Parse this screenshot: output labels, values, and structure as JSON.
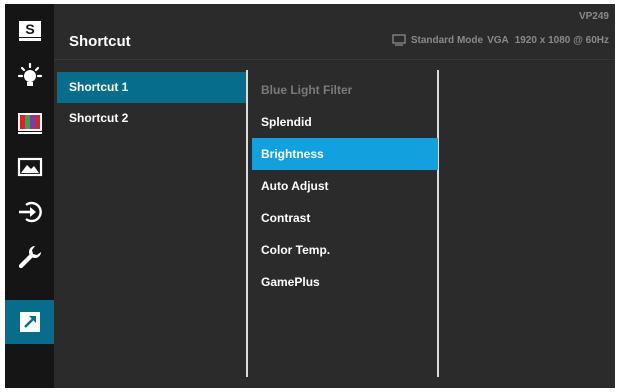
{
  "header": {
    "title": "Shortcut",
    "model": "VP249",
    "mode": "Standard Mode",
    "input": "VGA",
    "resolution": "1920 x 1080 @ 60Hz"
  },
  "sidebar": {
    "items": [
      {
        "icon": "splendid-s-icon"
      },
      {
        "icon": "blue-light-icon"
      },
      {
        "icon": "color-bars-icon"
      },
      {
        "icon": "image-icon"
      },
      {
        "icon": "input-select-icon"
      },
      {
        "icon": "system-setup-wrench-icon"
      },
      {
        "icon": "shortcut-arrow-icon",
        "active": true
      }
    ]
  },
  "shortcut_list": {
    "items": [
      {
        "label": "Shortcut 1",
        "selected": true
      },
      {
        "label": "Shortcut 2",
        "selected": false
      }
    ]
  },
  "function_list": {
    "items": [
      {
        "label": "Blue Light Filter",
        "state": "disabled"
      },
      {
        "label": "Splendid",
        "state": "normal"
      },
      {
        "label": "Brightness",
        "state": "selected"
      },
      {
        "label": "Auto Adjust",
        "state": "normal"
      },
      {
        "label": "Contrast",
        "state": "normal"
      },
      {
        "label": "Color Temp.",
        "state": "normal"
      },
      {
        "label": "GamePlus",
        "state": "normal"
      }
    ]
  },
  "colors": {
    "accent_sidebar": "#076d8d",
    "accent_selected": "#11a1df",
    "panel": "#2b2b2b",
    "sidebar": "#151515"
  }
}
